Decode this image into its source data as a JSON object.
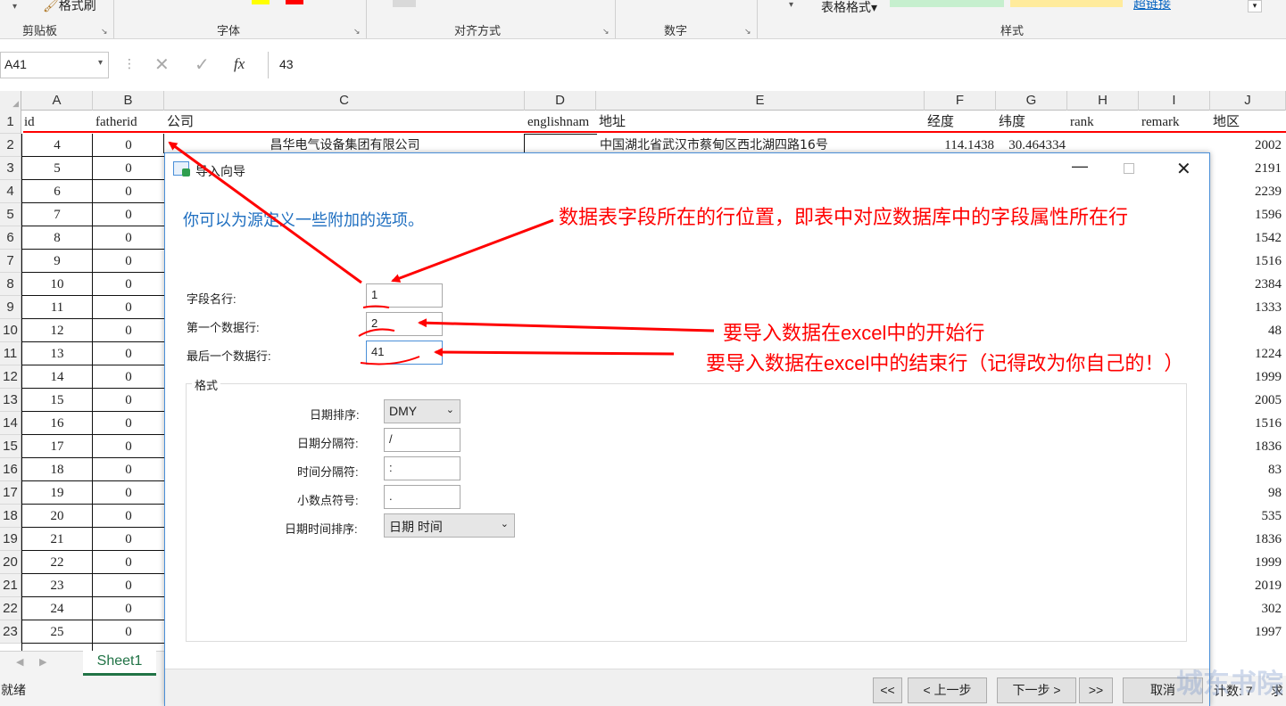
{
  "ribbon": {
    "format_painter": "格式刷",
    "table_format": "表格格式",
    "link_text": "超链接",
    "groups": {
      "clipboard": "剪贴板",
      "font": "字体",
      "alignment": "对齐方式",
      "number": "数字",
      "styles": "样式"
    }
  },
  "formula_bar": {
    "name_box": "A41",
    "formula": "43",
    "fx": "fx"
  },
  "columns": [
    "A",
    "B",
    "C",
    "D",
    "E",
    "F",
    "G",
    "H",
    "I",
    "J"
  ],
  "header_row": [
    "id",
    "fatherid",
    "公司",
    "englishnam",
    "地址",
    "经度",
    "纬度",
    "rank",
    "remark",
    "地区"
  ],
  "row2": {
    "c": "昌华电气设备集团有限公司",
    "e": "中国湖北省武汉市蔡甸区西北湖四路16号",
    "f": "114.1438",
    "g": "30.464334"
  },
  "row_numbers": [
    "1",
    "2",
    "3",
    "4",
    "5",
    "6",
    "7",
    "8",
    "9",
    "10",
    "11",
    "12",
    "13",
    "14",
    "15",
    "16",
    "17",
    "18",
    "19",
    "20",
    "21",
    "22",
    "23"
  ],
  "rows": [
    {
      "a": "4",
      "b": "0",
      "j": "2002"
    },
    {
      "a": "5",
      "b": "0",
      "j": "2191"
    },
    {
      "a": "6",
      "b": "0",
      "j": "2239"
    },
    {
      "a": "7",
      "b": "0",
      "j": "1596"
    },
    {
      "a": "8",
      "b": "0",
      "j": "1542"
    },
    {
      "a": "9",
      "b": "0",
      "j": "1516"
    },
    {
      "a": "10",
      "b": "0",
      "j": "2384"
    },
    {
      "a": "11",
      "b": "0",
      "j": "1333"
    },
    {
      "a": "12",
      "b": "0",
      "j": "48"
    },
    {
      "a": "13",
      "b": "0",
      "j": "1224"
    },
    {
      "a": "14",
      "b": "0",
      "j": "1999"
    },
    {
      "a": "15",
      "b": "0",
      "j": "2005"
    },
    {
      "a": "16",
      "b": "0",
      "j": "1516"
    },
    {
      "a": "17",
      "b": "0",
      "j": "1836"
    },
    {
      "a": "18",
      "b": "0",
      "j": "83"
    },
    {
      "a": "19",
      "b": "0",
      "j": "98"
    },
    {
      "a": "20",
      "b": "0",
      "j": "535"
    },
    {
      "a": "21",
      "b": "0",
      "j": "1836"
    },
    {
      "a": "22",
      "b": "0",
      "j": "1999"
    },
    {
      "a": "23",
      "b": "0",
      "j": "2019"
    },
    {
      "a": "24",
      "b": "0",
      "j": "302"
    },
    {
      "a": "25",
      "b": "0",
      "j": "1997"
    }
  ],
  "sheet_tab": "Sheet1",
  "status": {
    "ready": "就绪",
    "count": "计数: 7",
    "sum_partial": "求"
  },
  "dialog": {
    "title": "导入向导",
    "intro": "你可以为源定义一些附加的选项。",
    "field_name_row_label": "字段名行:",
    "field_name_row_value": "1",
    "first_data_row_label": "第一个数据行:",
    "first_data_row_value": "2",
    "last_data_row_label": "最后一个数据行:",
    "last_data_row_value": "41",
    "format_group": "格式",
    "date_order_label": "日期排序:",
    "date_order_value": "DMY",
    "date_sep_label": "日期分隔符:",
    "date_sep_value": "/",
    "time_sep_label": "时间分隔符:",
    "time_sep_value": ":",
    "decimal_label": "小数点符号:",
    "decimal_value": ".",
    "datetime_order_label": "日期时间排序:",
    "datetime_order_value": "日期 时间",
    "buttons": {
      "first": "<<",
      "prev": "< 上一步",
      "next": "下一步 >",
      "last": ">>",
      "cancel": "取消"
    }
  },
  "annotations": {
    "a1": "数据表字段所在的行位置，即表中对应数据库中的字段属性所在行",
    "a2": "要导入数据在excel中的开始行",
    "a3": "要导入数据在excel中的结束行（记得改为你自己的！）"
  },
  "watermark": "城东书院",
  "colors": {
    "annotation": "#ff0000",
    "dialog_border": "#4a8fd8",
    "intro_text": "#1f6fc0"
  }
}
